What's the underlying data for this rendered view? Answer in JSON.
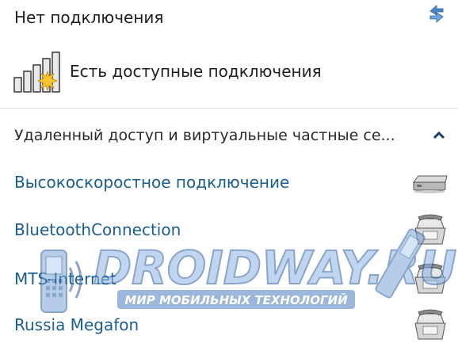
{
  "header": {
    "title": "Нет подключения",
    "refresh_icon": "refresh-icon"
  },
  "status": {
    "text": "Есть доступные подключения",
    "icon": "wifi-signal-icon"
  },
  "section": {
    "title": "Удаленный доступ и виртуальные частные се...",
    "expanded_icon": "chevron-up-icon"
  },
  "connections": [
    {
      "label": "Высокоскоростное подключение",
      "icon": "modem-icon"
    },
    {
      "label": "BluetoothConnection",
      "icon": "phone-icon"
    },
    {
      "label": "MTS-Internet",
      "icon": "phone-icon"
    },
    {
      "label": "Russia Megafon",
      "icon": "phone-icon"
    }
  ],
  "watermark": {
    "brand": "DROIDWAY.RU",
    "tagline": "МИР МОБИЛЬНЫХ ТЕХНОЛОГИЙ"
  },
  "colors": {
    "link": "#1a5d8f",
    "text": "#1f1f1f",
    "divider": "#d6dde5",
    "watermark": "#3b6fb3"
  }
}
